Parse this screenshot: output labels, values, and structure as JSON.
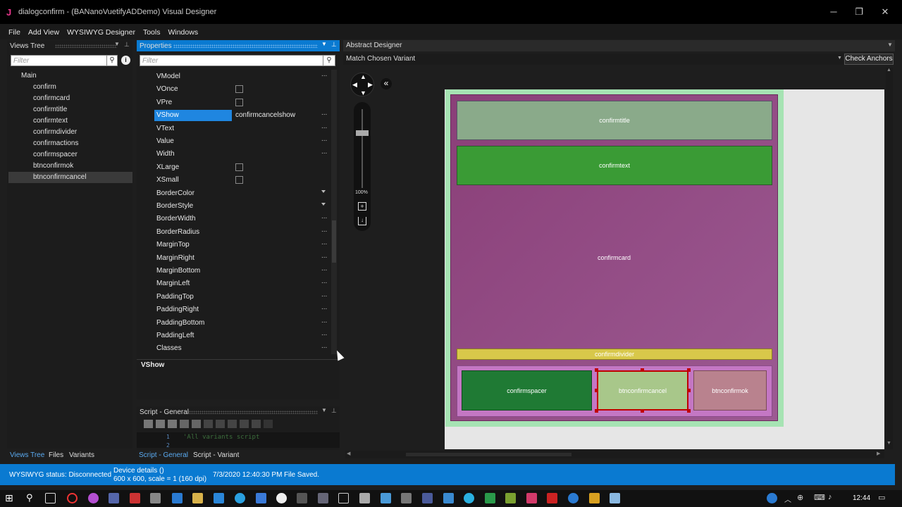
{
  "window": {
    "title": "dialogconfirm - (BANanoVuetifyADDemo) Visual Designer",
    "app_icon": "J",
    "minimize": "─",
    "maximize": "❐",
    "close": "✕"
  },
  "menu": [
    "File",
    "Add View",
    "WYSIWYG Designer",
    "Tools",
    "Windows"
  ],
  "views_tree": {
    "title": "Views Tree",
    "filter_placeholder": "Filter",
    "root": "Main",
    "items": [
      "confirm",
      "confirmcard",
      "confirmtitle",
      "confirmtext",
      "confirmdivider",
      "confirmactions",
      "confirmspacer",
      "btnconfirmok",
      "btnconfirmcancel"
    ],
    "selected": "btnconfirmcancel"
  },
  "properties": {
    "title": "Properties",
    "filter_placeholder": "Filter",
    "rows": [
      {
        "name": "VModel",
        "kind": "ellipsis",
        "value": ""
      },
      {
        "name": "VOnce",
        "kind": "check",
        "value": ""
      },
      {
        "name": "VPre",
        "kind": "check",
        "value": ""
      },
      {
        "name": "VShow",
        "kind": "ellipsis",
        "value": "confirmcancelshow"
      },
      {
        "name": "VText",
        "kind": "ellipsis",
        "value": ""
      },
      {
        "name": "Value",
        "kind": "ellipsis",
        "value": ""
      },
      {
        "name": "Width",
        "kind": "ellipsis",
        "value": ""
      },
      {
        "name": "XLarge",
        "kind": "check",
        "value": ""
      },
      {
        "name": "XSmall",
        "kind": "check",
        "value": ""
      },
      {
        "name": "BorderColor",
        "kind": "drop",
        "value": ""
      },
      {
        "name": "BorderStyle",
        "kind": "drop",
        "value": ""
      },
      {
        "name": "BorderWidth",
        "kind": "ellipsis",
        "value": ""
      },
      {
        "name": "BorderRadius",
        "kind": "ellipsis",
        "value": ""
      },
      {
        "name": "MarginTop",
        "kind": "ellipsis",
        "value": ""
      },
      {
        "name": "MarginRight",
        "kind": "ellipsis",
        "value": ""
      },
      {
        "name": "MarginBottom",
        "kind": "ellipsis",
        "value": ""
      },
      {
        "name": "MarginLeft",
        "kind": "ellipsis",
        "value": ""
      },
      {
        "name": "PaddingTop",
        "kind": "ellipsis",
        "value": ""
      },
      {
        "name": "PaddingRight",
        "kind": "ellipsis",
        "value": ""
      },
      {
        "name": "PaddingBottom",
        "kind": "ellipsis",
        "value": ""
      },
      {
        "name": "PaddingLeft",
        "kind": "ellipsis",
        "value": ""
      },
      {
        "name": "Classes",
        "kind": "ellipsis",
        "value": ""
      }
    ],
    "selected": "VShow",
    "description_title": "VShow",
    "ellipsis": "..."
  },
  "script": {
    "title": "Script - General",
    "line1_num": "1",
    "line1_text": "'All variants script",
    "line2_num": "2"
  },
  "bottom_tabs_left": [
    "Views Tree",
    "Files",
    "Variants"
  ],
  "bottom_tabs_script": [
    "Script - General",
    "Script - Variant"
  ],
  "designer": {
    "title": "Abstract Designer",
    "variant": "Match Chosen Variant",
    "check_anchors": "Check Anchors",
    "zoom": "100%",
    "collapse": "«",
    "views": {
      "title": "confirmtitle",
      "text": "confirmtext",
      "card": "confirmcard",
      "divider": "confirmdivider",
      "spacer": "confirmspacer",
      "cancel": "btnconfirmcancel",
      "ok": "btnconfirmok"
    }
  },
  "status": {
    "wysiwyg": "WYSIWYG status: Disconnected",
    "device_line1": "Device details ()",
    "device_line2": "600 x 600, scale = 1 (160 dpi)",
    "timestamp": "7/3/2020 12:40:30 PM",
    "message": "File Saved."
  },
  "taskbar": {
    "time": "12:44"
  },
  "colors": {
    "accent": "#0a7ad1",
    "card": "#8e4a7e",
    "title_view": "#8aaa8a",
    "text_view": "#3a9b35",
    "divider_view": "#d8c84a",
    "actions_view": "#c477c4",
    "spacer_view": "#1f7a34",
    "cancel_view": "#a8c78a",
    "ok_view": "#b9828e",
    "dialog_border": "#a6e3b3"
  }
}
